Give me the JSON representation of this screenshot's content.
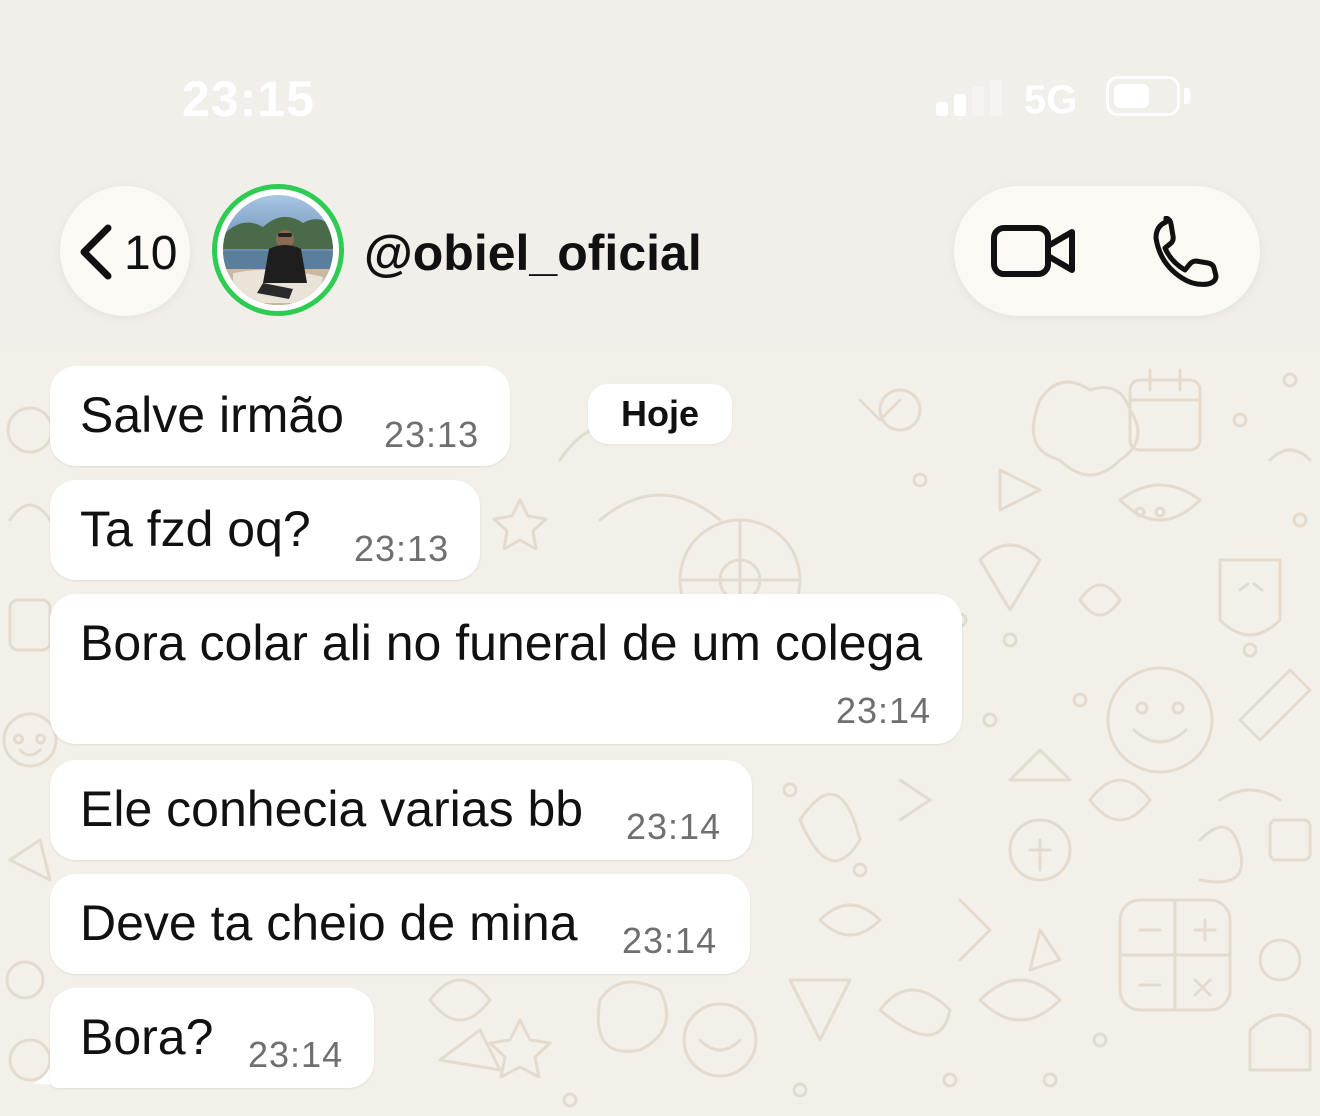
{
  "status_bar": {
    "time": "23:15",
    "network": "5G",
    "signal_bars_active": 2,
    "signal_bars_total": 4,
    "battery_level": 0.6
  },
  "header": {
    "back_count": "10",
    "contact_name": "@obiel_oficial",
    "icons": {
      "back": "chevron-left-icon",
      "video": "video-camera-icon",
      "phone": "phone-icon"
    }
  },
  "date_divider": "Hoje",
  "messages": [
    {
      "text": "Salve irmão",
      "time": "23:13"
    },
    {
      "text": "Ta fzd oq?",
      "time": "23:13"
    },
    {
      "text": "Bora colar ali no funeral de um colega",
      "time": "23:14"
    },
    {
      "text": "Ele conhecia varias bb",
      "time": "23:14"
    },
    {
      "text": "Deve ta cheio de mina",
      "time": "23:14"
    },
    {
      "text": "Bora?",
      "time": "23:14"
    }
  ],
  "colors": {
    "chat_background": "#f3efe9",
    "bubble": "#ffffff",
    "status_ring": "#2ecc52",
    "timestamp": "#6f6f6f"
  }
}
